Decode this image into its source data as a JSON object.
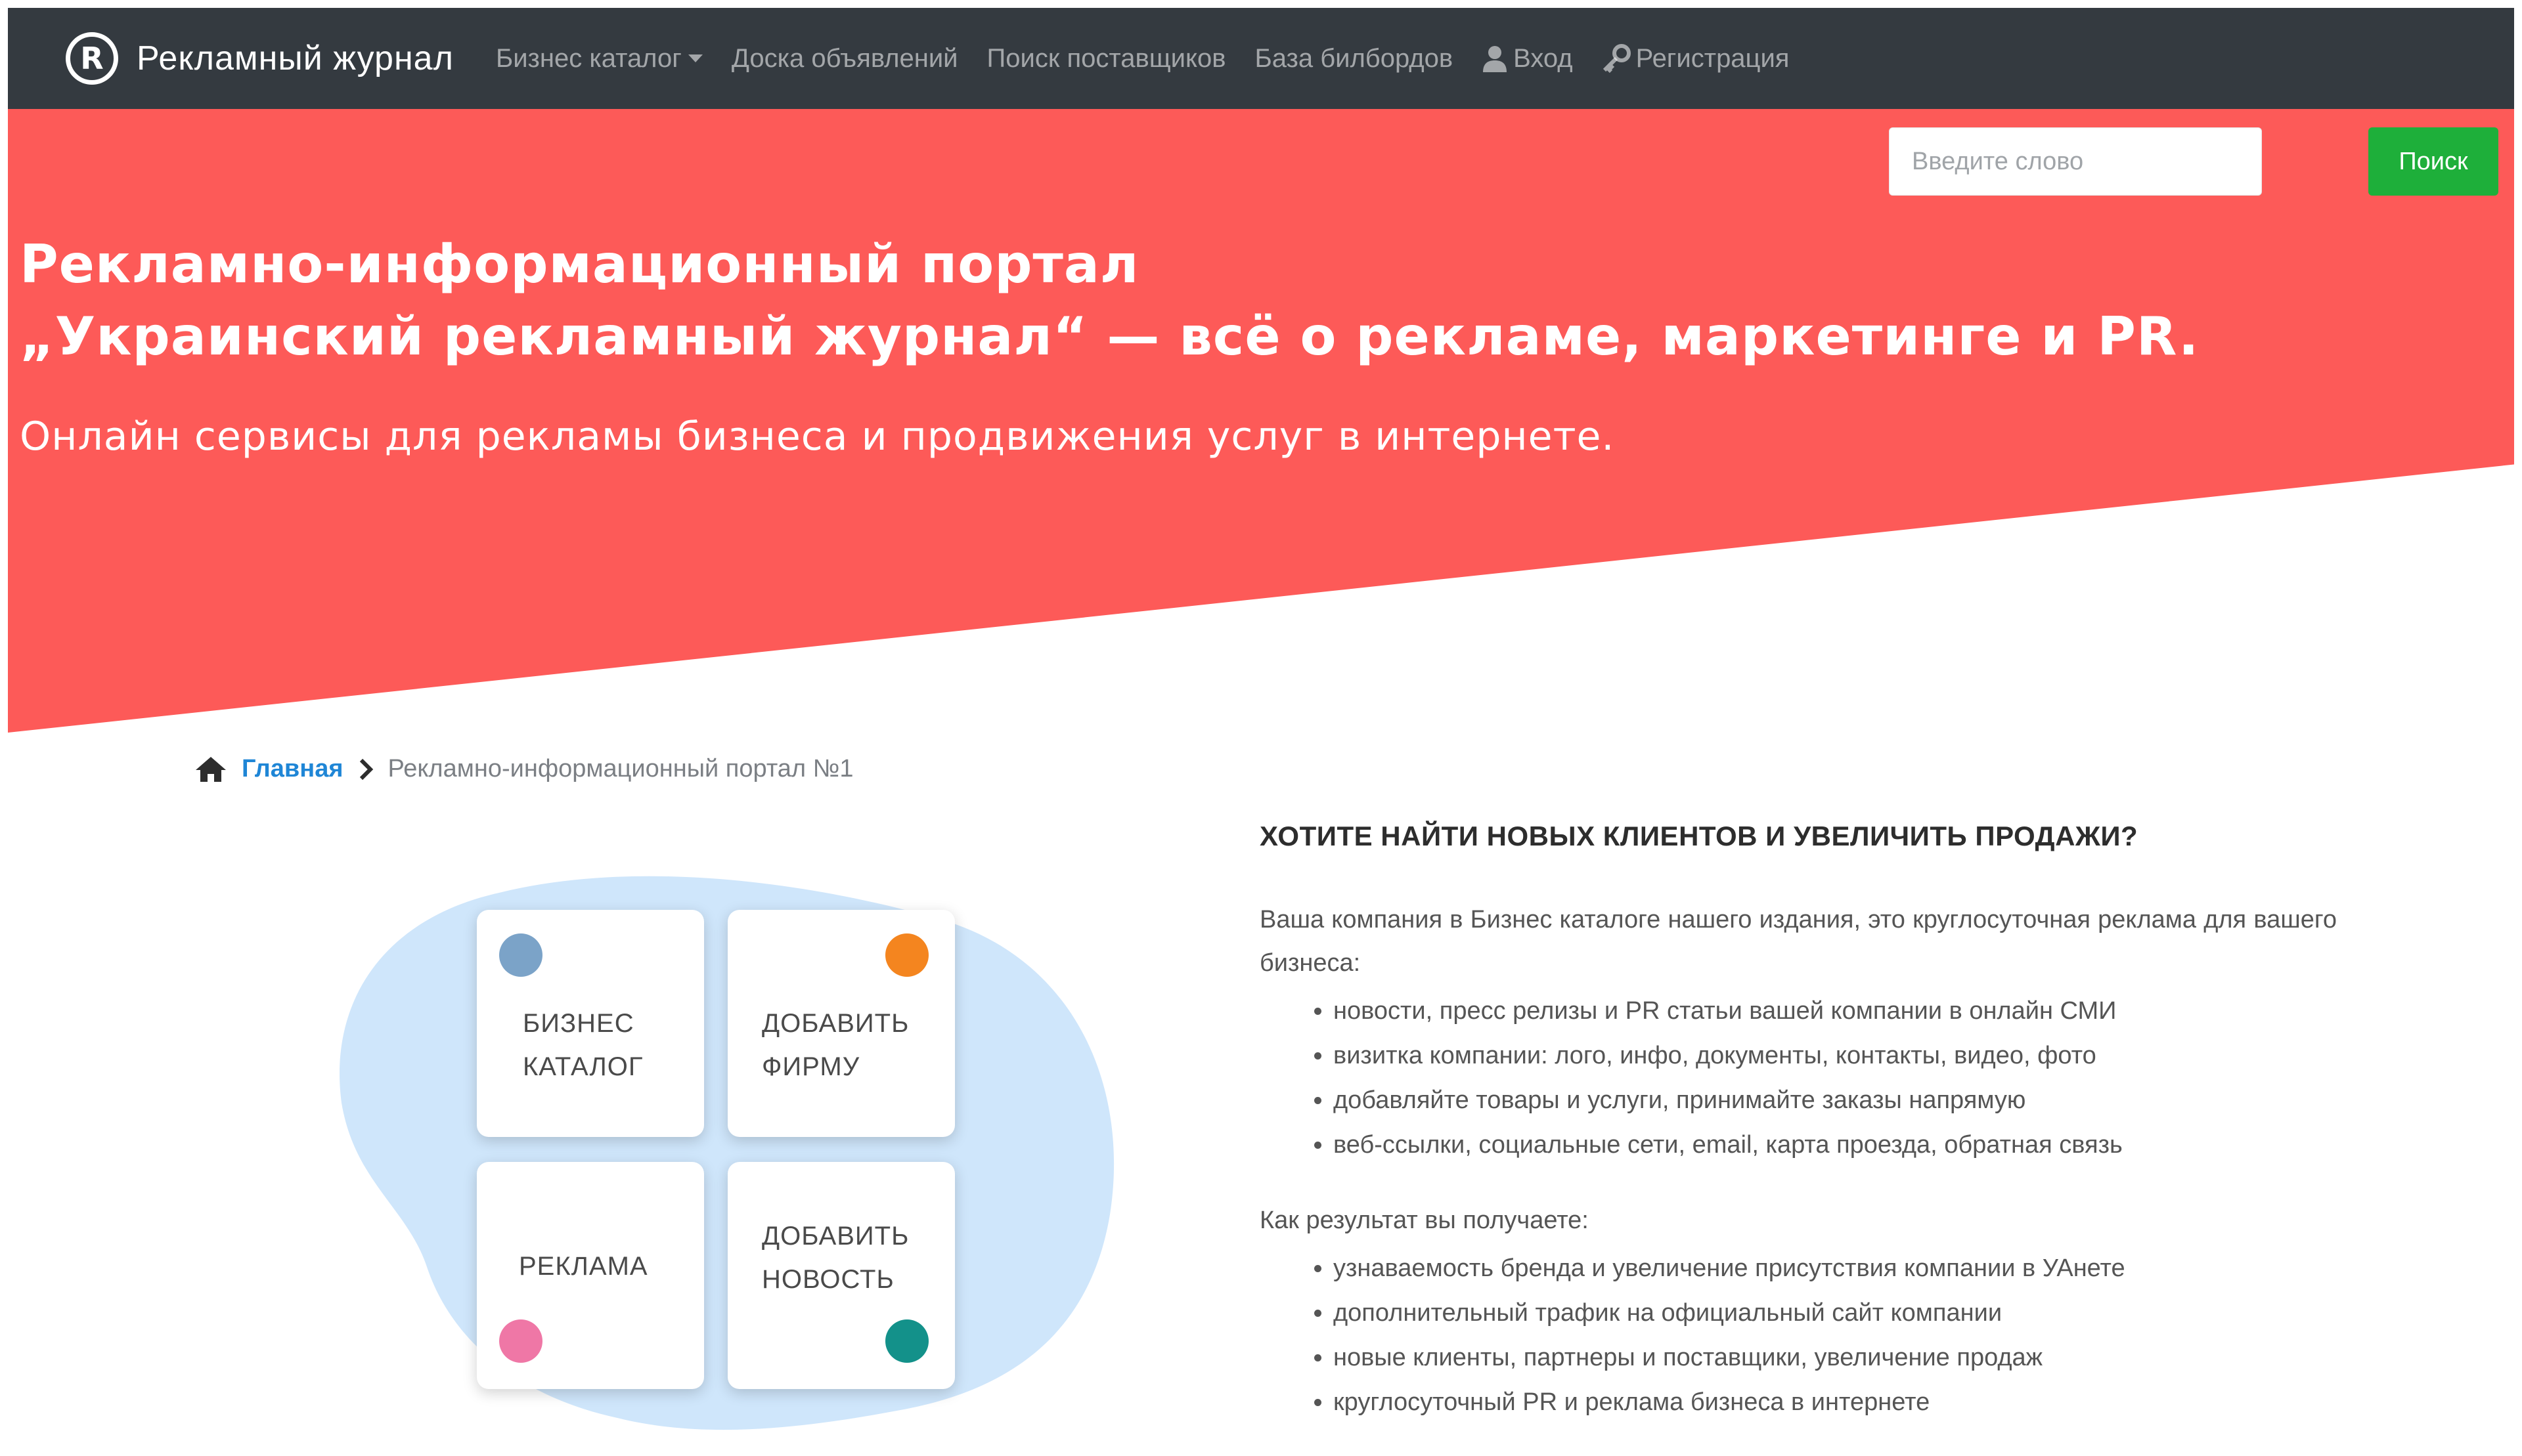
{
  "navbar": {
    "brand_logo": "R",
    "brand_name": "Рекламный журнал",
    "links": [
      {
        "label": "Бизнес каталог",
        "dropdown": true
      },
      {
        "label": "Доска объявлений"
      },
      {
        "label": "Поиск поставщиков"
      },
      {
        "label": "База билбордов"
      },
      {
        "label": "Вход",
        "icon": "user-icon"
      },
      {
        "label": "Регистрация",
        "icon": "key-icon"
      }
    ]
  },
  "search": {
    "placeholder": "Введите слово",
    "button_label": "Поиск"
  },
  "hero": {
    "title_line1": "Рекламно-информационный портал",
    "title_line2": "„Украинский рекламный журнал“ — всё о рекламе, маркетинге и PR.",
    "subtitle": "Онлайн сервисы для рекламы бизнеса и продвижения услуг в интернете."
  },
  "breadcrumb": {
    "home": "Главная",
    "current": "Рекламно-информационный портал №1"
  },
  "tiles": [
    {
      "line1": "Бизнес",
      "line2": "каталог",
      "dot_color": "#7ba3c8"
    },
    {
      "line1": "Добавить",
      "line2": "фирму",
      "dot_color": "#f4851f"
    },
    {
      "line1": "Реклама",
      "line2": "",
      "dot_color": "#ef77a6"
    },
    {
      "line1": "Добавить",
      "line2": "новость",
      "dot_color": "#13918a"
    }
  ],
  "content": {
    "heading": "ХОТИТЕ НАЙТИ НОВЫХ КЛИЕНТОВ И УВЕЛИЧИТЬ ПРОДАЖИ?",
    "intro": "Ваша компания в Бизнес каталоге нашего издания, это круглосуточная реклама для вашего бизнеса:",
    "list1": [
      "новости, пресс релизы и PR статьи вашей компании в онлайн СМИ",
      "визитка компании: лого, инфо, документы, контакты, видео, фото",
      "добавляйте товары и услуги, принимайте заказы напрямую",
      "веб-ссылки, социальные сети, email, карта проезда, обратная связь"
    ],
    "result_intro": "Как результат вы получаете:",
    "list2": [
      "узнаваемость бренда и увеличение присутствия компании в УАнете",
      "дополнительный трафик на официальный сайт компании",
      "новые клиенты, партнеры и поставщики, увеличение продаж",
      "круглосуточный PR и реклама бизнеса в интернете"
    ]
  },
  "colors": {
    "navbar_bg": "#343a40",
    "hero_bg": "#fd5a58",
    "search_button": "#1eaf3a",
    "link_blue": "#1f86d6",
    "blob": "#cfe6fb"
  }
}
